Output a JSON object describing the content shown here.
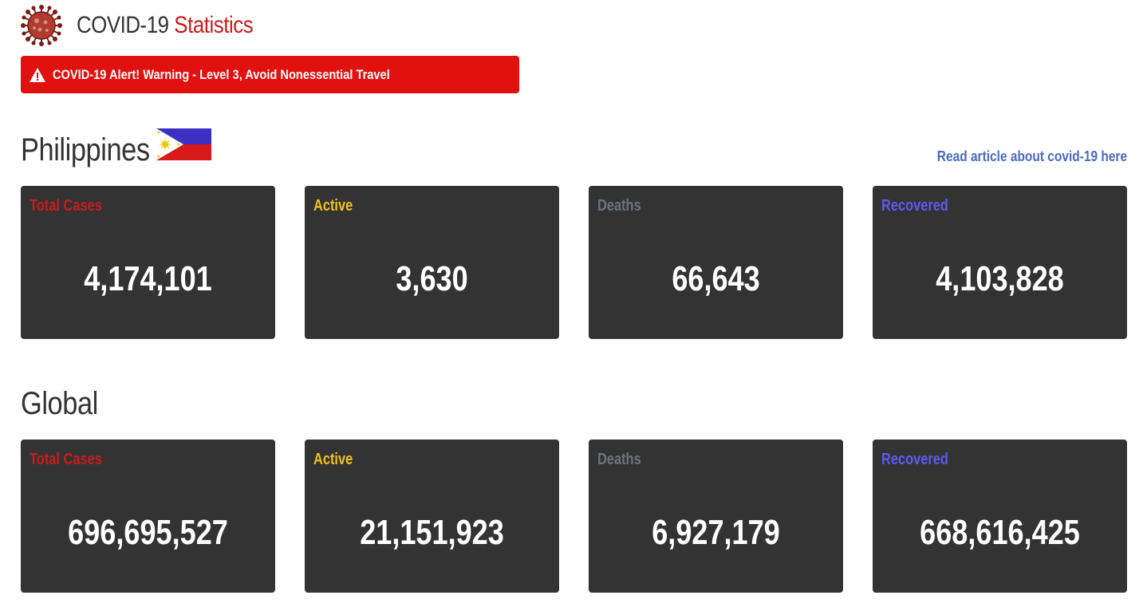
{
  "app": {
    "title_main": "COVID-19",
    "title_accent": "Statistics"
  },
  "alert": {
    "text": "COVID-19 Alert! Warning - Level 3, Avoid Nonessential Travel"
  },
  "philippines": {
    "title": "Philippines",
    "article_link": "Read article about covid-19 here",
    "cards": [
      {
        "label": "Total Cases",
        "value": "4,174,101",
        "color": "#c81d1d"
      },
      {
        "label": "Active",
        "value": "3,630",
        "color": "#f2c21a"
      },
      {
        "label": "Deaths",
        "value": "66,643",
        "color": "#6e7280"
      },
      {
        "label": "Recovered",
        "value": "4,103,828",
        "color": "#5b5bf0"
      }
    ]
  },
  "global": {
    "title": "Global",
    "cards": [
      {
        "label": "Total Cases",
        "value": "696,695,527",
        "color": "#c81d1d"
      },
      {
        "label": "Active",
        "value": "21,151,923",
        "color": "#f2c21a"
      },
      {
        "label": "Deaths",
        "value": "6,927,179",
        "color": "#6e7280"
      },
      {
        "label": "Recovered",
        "value": "668,616,425",
        "color": "#5b5bf0"
      }
    ]
  },
  "icons": {
    "logo": "coronavirus-icon",
    "alert": "warning-triangle-icon",
    "flag": "philippines-flag-icon"
  }
}
